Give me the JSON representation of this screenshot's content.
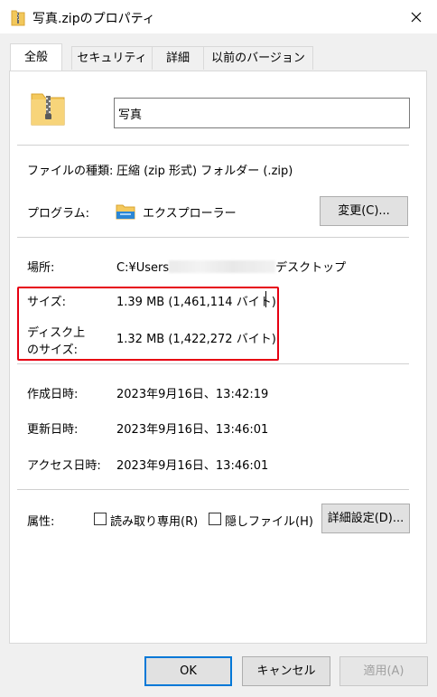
{
  "window": {
    "title": "写真.zipのプロパティ",
    "close_icon": "close-icon"
  },
  "tabs": [
    "全般",
    "セキュリティ",
    "詳細",
    "以前のバージョン"
  ],
  "general": {
    "file_name": "写真",
    "file_type_label": "ファイルの種類:",
    "file_type_value": "圧縮 (zip 形式) フォルダー (.zip)",
    "program_label": "プログラム:",
    "program_value": "エクスプローラー",
    "change_button": "変更(C)...",
    "location_label": "場所:",
    "location_prefix": "C:¥Users",
    "location_suffix": "デスクトップ",
    "size_label": "サイズ:",
    "size_value": "1.39 MB (1,461,114 バイト)",
    "disk_size_label_1": "ディスク上",
    "disk_size_label_2": "のサイズ:",
    "disk_size_value": "1.32 MB (1,422,272 バイト)",
    "created_label": "作成日時:",
    "created_value": "2023年9月16日、13:42:19",
    "modified_label": "更新日時:",
    "modified_value": "2023年9月16日、13:46:01",
    "accessed_label": "アクセス日時:",
    "accessed_value": "2023年9月16日、13:46:01",
    "attributes_label": "属性:",
    "readonly_label": "読み取り専用(R)",
    "hidden_label": "隠しファイル(H)",
    "advanced_button": "詳細設定(D)..."
  },
  "footer": {
    "ok": "OK",
    "cancel": "キャンセル",
    "apply": "適用(A)"
  },
  "colors": {
    "highlight": "#e60012",
    "zip_folder": "#f2c85b"
  }
}
